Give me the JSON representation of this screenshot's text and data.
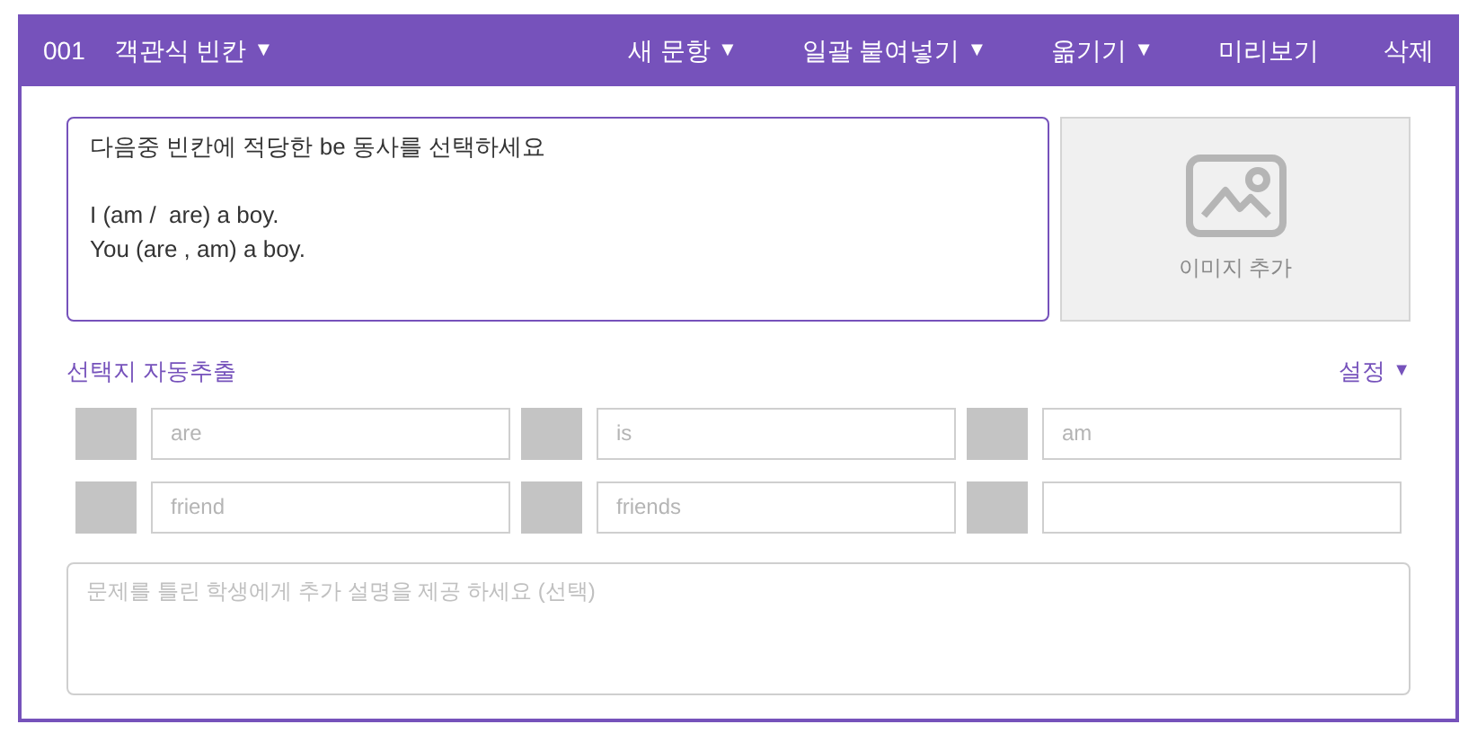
{
  "header": {
    "number": "001",
    "type_label": "객관식 빈칸",
    "type_caret": "▼",
    "actions": [
      {
        "label": "새 문항",
        "caret": "▼"
      },
      {
        "label": "일괄 붙여넣기",
        "caret": "▼"
      },
      {
        "label": "옮기기",
        "caret": "▼"
      },
      {
        "label": "미리보기"
      },
      {
        "label": "삭제"
      }
    ]
  },
  "question": {
    "value": "다음중 빈칸에 적당한 be 동사를 선택하세요\n\nI (am /  are) a boy.\nYou (are , am) a boy."
  },
  "image_button": {
    "label": "이미지 추가"
  },
  "auto_extract": {
    "label": "선택지 자동추출"
  },
  "settings": {
    "label": "설정",
    "caret": "▼"
  },
  "choices": [
    {
      "kind": "hinted",
      "placeholder": "are"
    },
    {
      "kind": "hinted",
      "placeholder": "is"
    },
    {
      "kind": "hinted",
      "placeholder": "am"
    },
    {
      "kind": "hinted",
      "placeholder": "friend"
    },
    {
      "kind": "hinted",
      "placeholder": "friends"
    },
    {
      "kind": "blank"
    }
  ],
  "explanation": {
    "placeholder": "문제를 틀린 학생에게 추가 설명을 제공 하세요 (선택)"
  }
}
